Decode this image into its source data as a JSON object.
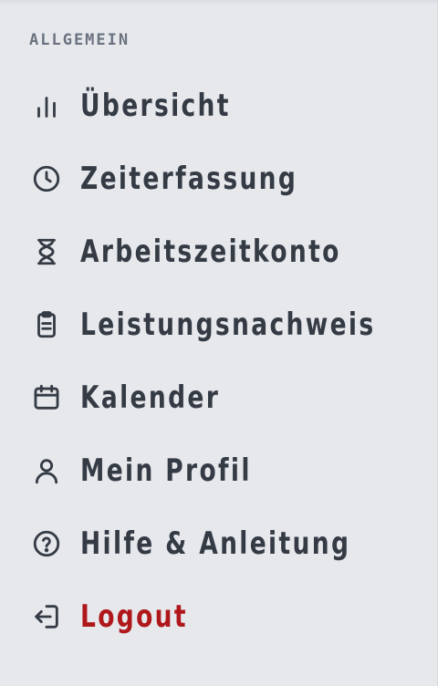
{
  "section": {
    "title": "ALLGEMEIN"
  },
  "nav": {
    "items": [
      {
        "label": "Übersicht",
        "icon": "bar-chart-icon"
      },
      {
        "label": "Zeiterfassung",
        "icon": "clock-icon"
      },
      {
        "label": "Arbeitszeitkonto",
        "icon": "hourglass-icon"
      },
      {
        "label": "Leistungsnachweis",
        "icon": "clipboard-icon"
      },
      {
        "label": "Kalender",
        "icon": "calendar-icon"
      },
      {
        "label": "Mein Profil",
        "icon": "user-icon"
      },
      {
        "label": "Hilfe & Anleitung",
        "icon": "help-circle-icon"
      },
      {
        "label": "Logout",
        "icon": "logout-icon"
      }
    ]
  },
  "colors": {
    "background": "#e6e8ec",
    "text": "#353b45",
    "section_title": "#6b7381",
    "logout": "#b0171b"
  }
}
